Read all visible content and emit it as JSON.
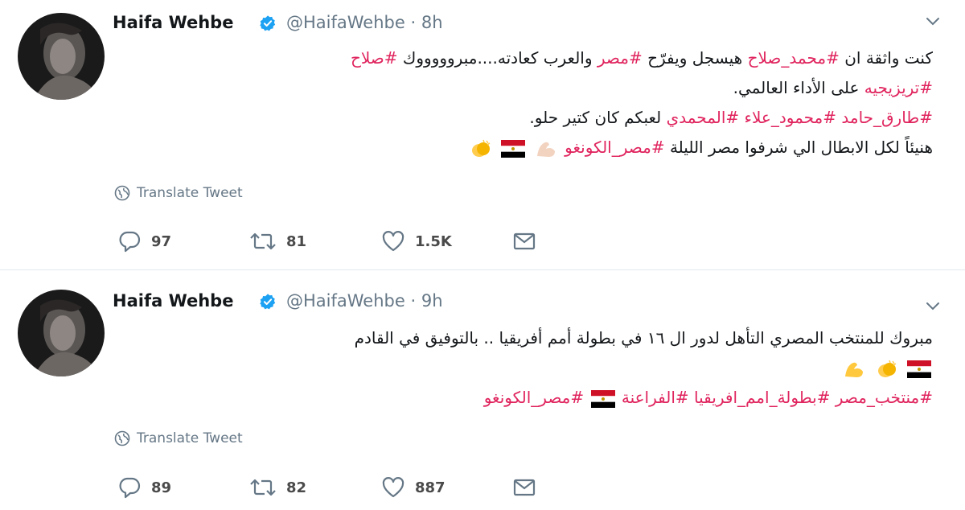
{
  "tweets": [
    {
      "author": {
        "name": "Haifa Wehbe",
        "handle": "@HaifaWehbe",
        "time": "8h"
      },
      "lines": [
        [
          {
            "t": "كنت واثقة ان ",
            "h": false
          },
          {
            "t": "#محمد_صلاح",
            "h": true
          },
          {
            "t": " هيسجل ويفرّح ",
            "h": false
          },
          {
            "t": "#مصر",
            "h": true
          },
          {
            "t": " والعرب كعادته....مبروووووك ",
            "h": false
          },
          {
            "t": "#صلاح",
            "h": true
          }
        ],
        [
          {
            "t": "#تريزيجيه",
            "h": true
          },
          {
            "t": " على الأداء العالمي.",
            "h": false
          }
        ],
        [
          {
            "t": " #طارق_حامد ",
            "h": true
          },
          {
            "t": "#محمود_علاء ",
            "h": true
          },
          {
            "t": "#المحمدي",
            "h": true
          },
          {
            "t": " لعبكم كان كتير حلو.",
            "h": false
          }
        ],
        [
          {
            "t": "هنيئاً لكل الابطال الي شرفوا مصر الليلة ",
            "h": false
          },
          {
            "t": "#مصر_الكونغو",
            "h": true
          }
        ]
      ],
      "translate_label": "Translate Tweet",
      "stats": {
        "replies": "97",
        "retweets": "81",
        "likes": "1.5K"
      }
    },
    {
      "author": {
        "name": "Haifa Wehbe",
        "handle": "@HaifaWehbe",
        "time": "9h"
      },
      "lines": [
        [
          {
            "t": "مبروك للمنتخب المصري التأهل لدور ال ١٦ في بطولة أمم أفريقيا .. بالتوفيق في القادم",
            "h": false
          }
        ],
        [],
        [
          {
            "t": "#منتخب_مصر ",
            "h": true
          },
          {
            "t": "#بطولة_امم_افريقيا ",
            "h": true
          },
          {
            "t": "#الفراعنة",
            "h": true
          },
          {
            "t": " ",
            "h": false
          },
          {
            "t": " #مصر_الكونغو",
            "h": true
          }
        ]
      ],
      "translate_label": "Translate Tweet",
      "stats": {
        "replies": "89",
        "retweets": "82",
        "likes": "887"
      }
    }
  ],
  "icons": {
    "verified": "verified-badge-icon",
    "caret": "chevron-down-icon",
    "globe": "globe-icon",
    "reply": "reply-icon",
    "retweet": "retweet-icon",
    "like": "heart-icon",
    "dm": "envelope-icon",
    "flag": "egypt-flag-emoji",
    "muscle": "flexed-biceps-emoji",
    "clap": "clapping-hands-emoji"
  },
  "colors": {
    "hashtag": "#e0245e",
    "handle": "#657786",
    "verified": "#1da1f2",
    "text": "#14171a"
  }
}
